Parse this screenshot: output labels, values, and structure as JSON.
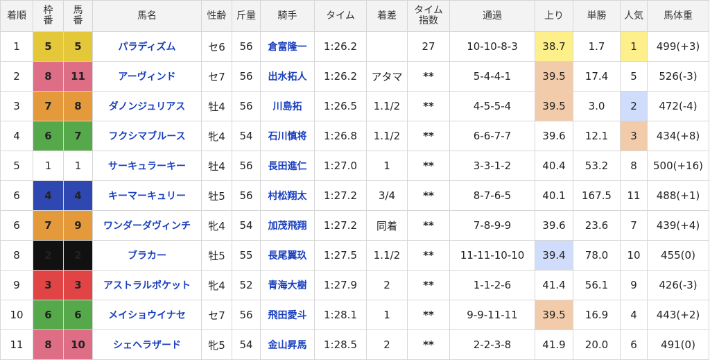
{
  "headers": {
    "rank": "着順",
    "waku": [
      "枠",
      "番"
    ],
    "umaban": [
      "馬",
      "番"
    ],
    "name": "馬名",
    "sexage": "性齢",
    "kinryo": "斤量",
    "jockey": "騎手",
    "time": "タイム",
    "margin": "着差",
    "index": [
      "タイム",
      "指数"
    ],
    "passing": "通過",
    "last3f": "上り",
    "odds": "単勝",
    "pop": "人気",
    "weight": "馬体重"
  },
  "colors": {
    "waku_1": "#ffffff",
    "waku_2": "#111111",
    "waku_3": "#e04444",
    "waku_4": "#2f47b0",
    "waku_5": "#e5c83a",
    "waku_6": "#56a94a",
    "waku_7": "#e49a3b",
    "waku_8": "#dd6e86",
    "highlight_1st": "#fdf08b",
    "highlight_2nd": "#f2ccaa",
    "highlight_3rd": "#cfdcfb",
    "link": "#1a3fbf"
  },
  "rows": [
    {
      "rank": "1",
      "waku": "5",
      "umaban": "5",
      "name": "パラディズム",
      "sexage": "セ6",
      "kinryo": "56",
      "jockey": "倉富隆一",
      "time": "1:26.2",
      "margin": "",
      "index": "27",
      "passing": "10-10-8-3",
      "last3f": "38.7",
      "odds": "1.7",
      "pop": "1",
      "weight": "499(+3)"
    },
    {
      "rank": "2",
      "waku": "8",
      "umaban": "11",
      "name": "アーヴィンド",
      "sexage": "セ7",
      "kinryo": "56",
      "jockey": "出水拓人",
      "time": "1:26.2",
      "margin": "アタマ",
      "index": "**",
      "passing": "5-4-4-1",
      "last3f": "39.5",
      "odds": "17.4",
      "pop": "5",
      "weight": "526(-3)"
    },
    {
      "rank": "3",
      "waku": "7",
      "umaban": "8",
      "name": "ダノンジュリアス",
      "sexage": "牡4",
      "kinryo": "56",
      "jockey": "川島拓",
      "time": "1:26.5",
      "margin": "1.1/2",
      "index": "**",
      "passing": "4-5-5-4",
      "last3f": "39.5",
      "odds": "3.0",
      "pop": "2",
      "weight": "472(-4)"
    },
    {
      "rank": "4",
      "waku": "6",
      "umaban": "7",
      "name": "フクシマブルース",
      "sexage": "牝4",
      "kinryo": "54",
      "jockey": "石川慎将",
      "time": "1:26.8",
      "margin": "1.1/2",
      "index": "**",
      "passing": "6-6-7-7",
      "last3f": "39.6",
      "odds": "12.1",
      "pop": "3",
      "weight": "434(+8)"
    },
    {
      "rank": "5",
      "waku": "1",
      "umaban": "1",
      "name": "サーキュラーキー",
      "sexage": "牡4",
      "kinryo": "56",
      "jockey": "長田進仁",
      "time": "1:27.0",
      "margin": "1",
      "index": "**",
      "passing": "3-3-1-2",
      "last3f": "40.4",
      "odds": "53.2",
      "pop": "8",
      "weight": "500(+16)"
    },
    {
      "rank": "6",
      "waku": "4",
      "umaban": "4",
      "name": "キーマーキュリー",
      "sexage": "牡5",
      "kinryo": "56",
      "jockey": "村松翔太",
      "time": "1:27.2",
      "margin": "3/4",
      "index": "**",
      "passing": "8-7-6-5",
      "last3f": "40.1",
      "odds": "167.5",
      "pop": "11",
      "weight": "488(+1)"
    },
    {
      "rank": "6",
      "waku": "7",
      "umaban": "9",
      "name": "ワンダーダヴィンチ",
      "sexage": "牝4",
      "kinryo": "54",
      "jockey": "加茂飛翔",
      "time": "1:27.2",
      "margin": "同着",
      "index": "**",
      "passing": "7-8-9-9",
      "last3f": "39.6",
      "odds": "23.6",
      "pop": "7",
      "weight": "439(+4)"
    },
    {
      "rank": "8",
      "waku": "2",
      "umaban": "2",
      "name": "ブラカー",
      "sexage": "牡5",
      "kinryo": "55",
      "jockey": "長尾翼玖",
      "time": "1:27.5",
      "margin": "1.1/2",
      "index": "**",
      "passing": "11-11-10-10",
      "last3f": "39.4",
      "odds": "78.0",
      "pop": "10",
      "weight": "455(0)"
    },
    {
      "rank": "9",
      "waku": "3",
      "umaban": "3",
      "name": "アストラルポケット",
      "sexage": "牝4",
      "kinryo": "52",
      "jockey": "青海大樹",
      "time": "1:27.9",
      "margin": "2",
      "index": "**",
      "passing": "1-1-2-6",
      "last3f": "41.4",
      "odds": "56.1",
      "pop": "9",
      "weight": "426(-3)"
    },
    {
      "rank": "10",
      "waku": "6",
      "umaban": "6",
      "name": "メイショウイナセ",
      "sexage": "セ7",
      "kinryo": "56",
      "jockey": "飛田愛斗",
      "time": "1:28.1",
      "margin": "1",
      "index": "**",
      "passing": "9-9-11-11",
      "last3f": "39.5",
      "odds": "16.9",
      "pop": "4",
      "weight": "443(+2)"
    },
    {
      "rank": "11",
      "waku": "8",
      "umaban": "10",
      "name": "シェヘラザード",
      "sexage": "牝5",
      "kinryo": "54",
      "jockey": "金山昇馬",
      "time": "1:28.5",
      "margin": "2",
      "index": "**",
      "passing": "2-2-3-8",
      "last3f": "41.9",
      "odds": "20.0",
      "pop": "6",
      "weight": "491(0)"
    }
  ]
}
